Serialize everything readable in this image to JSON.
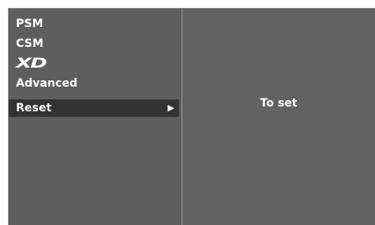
{
  "menu": {
    "items": [
      {
        "label": "PSM"
      },
      {
        "label": "CSM"
      },
      {
        "label": "XD"
      },
      {
        "label": "Advanced"
      },
      {
        "label": "Reset",
        "selected": true
      }
    ],
    "selected_arrow_icon": "right-triangle-icon"
  },
  "detail": {
    "hint": "To set"
  },
  "colors": {
    "background": "#626262",
    "selected_row": "#333333",
    "text": "#ffffff"
  }
}
